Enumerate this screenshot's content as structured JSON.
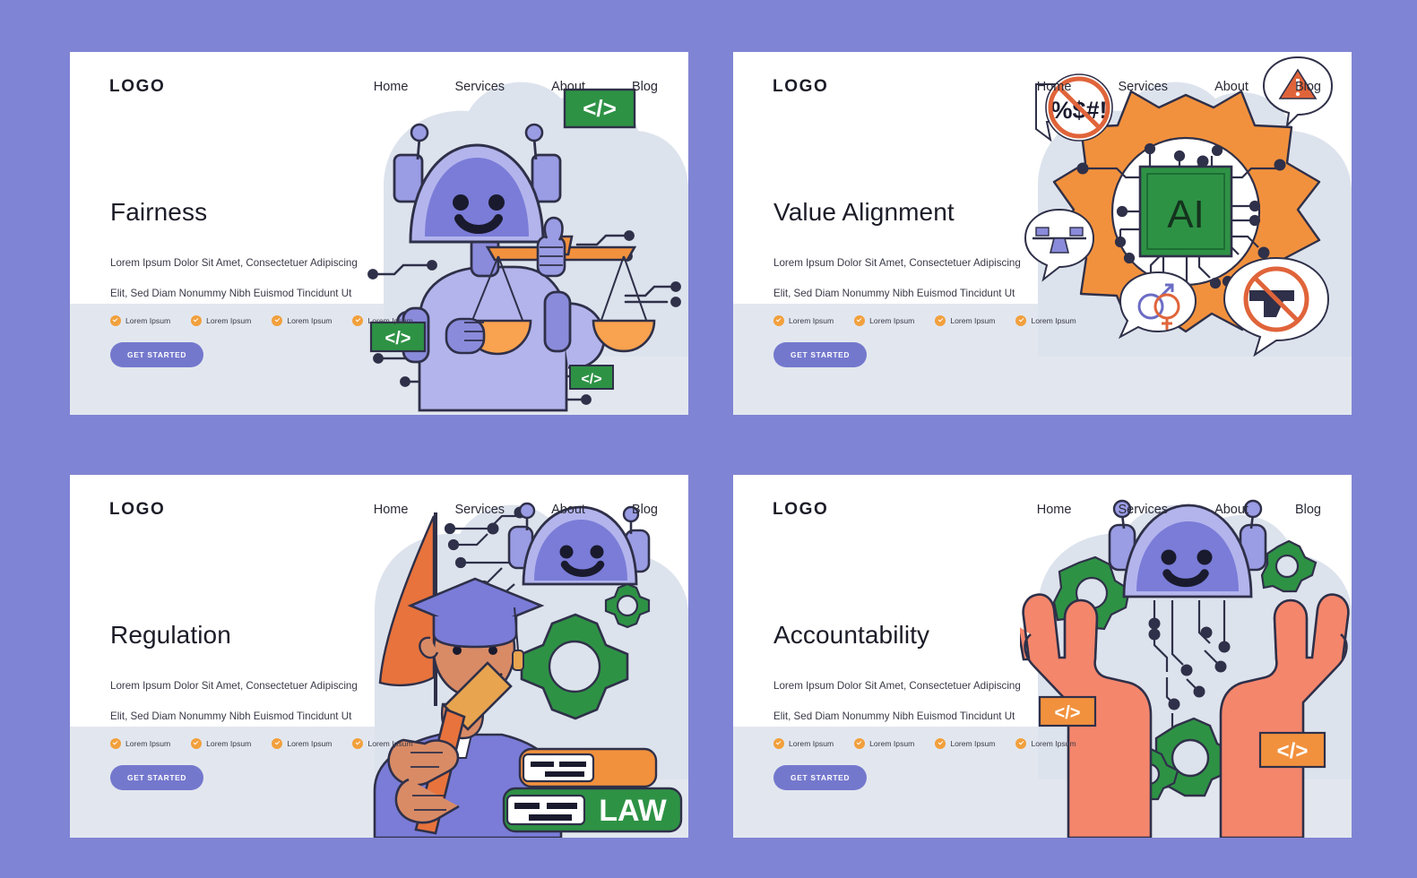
{
  "background_color": "#8084d4",
  "card_bg": "#ffffff",
  "card_lower_band": "#e2e7ef",
  "accent_purple": "#7478cd",
  "accent_orange": "#f2913d",
  "accent_green": "#2e9245",
  "nav": {
    "logo": "LOGO",
    "links": [
      "Home",
      "Services",
      "About",
      "Blog"
    ]
  },
  "common": {
    "paragraph_line1": "Lorem Ipsum Dolor Sit Amet, Consectetuer Adipiscing",
    "paragraph_line2": "Elit, Sed Diam Nonummy Nibh Euismod Tincidunt Ut",
    "features": [
      "Lorem Ipsum",
      "Lorem Ipsum",
      "Lorem Ipsum",
      "Lorem Ipsum"
    ],
    "cta_label": "GET STARTED"
  },
  "cards": [
    {
      "id": "fairness",
      "title": "Fairness",
      "illustration": "robot-holding-scales-of-justice",
      "badges": [
        "</>",
        "</>",
        "</>"
      ]
    },
    {
      "id": "value-alignment",
      "title": "Value Alignment",
      "illustration": "ai-chip-in-gear-with-restriction-bubbles",
      "chip_label": "AI",
      "bubbles": [
        "%$#!",
        "warning-triangle",
        "balance-scale",
        "gender-symbols",
        "no-gun"
      ]
    },
    {
      "id": "regulation",
      "title": "Regulation",
      "illustration": "graduate-judge-with-gavel-flag-gears-and-law-books",
      "book_label": "LAW"
    },
    {
      "id": "accountability",
      "title": "Accountability",
      "illustration": "two-hands-holding-robot-head-with-gears",
      "badges": [
        "</>",
        "</>"
      ]
    }
  ]
}
